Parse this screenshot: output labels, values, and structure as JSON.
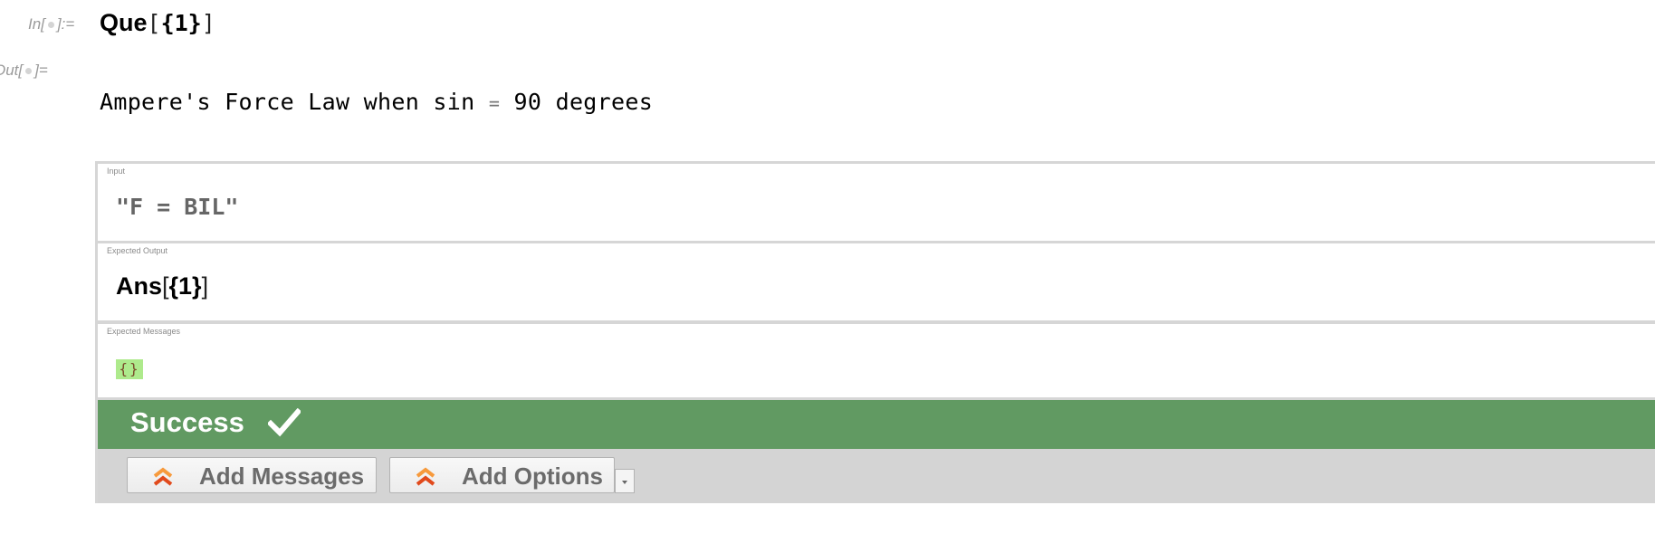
{
  "cell_labels": {
    "in_prefix": "In[",
    "in_suffix": "]:=",
    "out_prefix": "Out[",
    "out_suffix": "]="
  },
  "input_cell": {
    "function": "Que",
    "open": "[",
    "arg": "{1}",
    "close": "]"
  },
  "output_cell": {
    "text_before": "Ampere's Force Law when sin ",
    "equals": "=",
    "text_after": " 90 degrees"
  },
  "test_panel": {
    "input": {
      "caption": "Input",
      "value": "\"F = BIL\""
    },
    "expected_output": {
      "caption": "Expected Output",
      "function": "Ans",
      "open": "[",
      "arg": "{1}",
      "close": "]"
    },
    "expected_messages": {
      "caption": "Expected Messages",
      "value": "{}"
    },
    "status": {
      "label": "Success",
      "icon": "checkmark-icon",
      "color": "#619a62"
    },
    "toolbar": {
      "add_messages_label": "Add Messages",
      "add_options_label": "Add Options",
      "icon": "double-chevron-up-icon",
      "dropdown_icon": "triangle-down-icon"
    }
  }
}
